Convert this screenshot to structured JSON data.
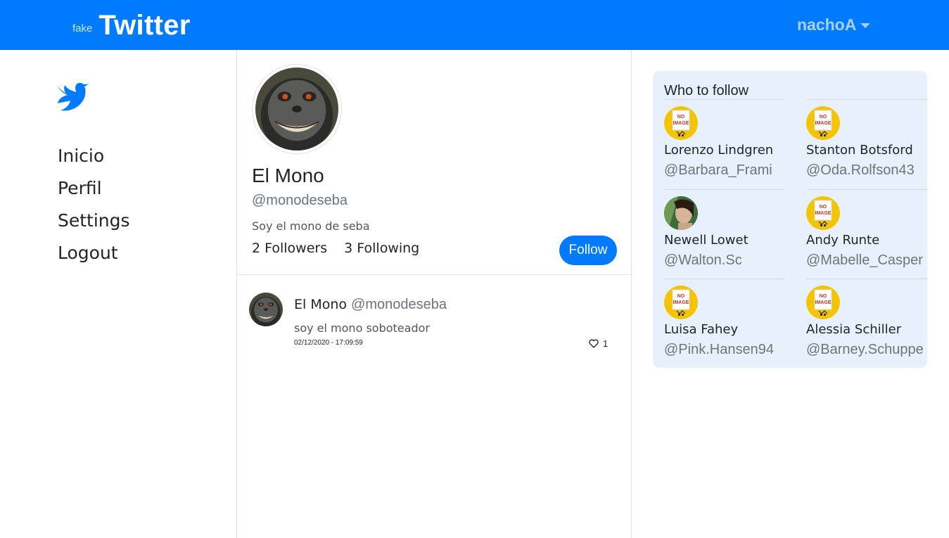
{
  "navbar": {
    "brand_small": "fake",
    "brand_big": "Twitter",
    "user": "nachoA",
    "colors": {
      "primary": "#007bff"
    }
  },
  "sidebar": {
    "logo_icon": "bird-icon",
    "items": [
      {
        "label": "Inicio"
      },
      {
        "label": "Perfil"
      },
      {
        "label": "Settings"
      },
      {
        "label": "Logout"
      }
    ]
  },
  "profile": {
    "name": "El Mono",
    "handle": "@monodeseba",
    "bio": "Soy el mono de seba",
    "followers": "2 Followers",
    "following": "3 Following",
    "follow_label": "Follow"
  },
  "tweets": [
    {
      "author": "El Mono",
      "handle": "@monodeseba",
      "text": "soy el mono soboteador",
      "date": "02/12/2020 - 17:09:59",
      "likes": "1"
    }
  ],
  "who_to_follow": {
    "title": "Who to follow",
    "users": [
      {
        "name": "Lorenzo Lindgren",
        "handle": "@Barbara_Frami",
        "avatar": "no-image"
      },
      {
        "name": "Stanton Botsford",
        "handle": "@Oda.Rolfson43",
        "avatar": "no-image"
      },
      {
        "name": "Newell Lowet",
        "handle": "@Walton.Sc",
        "avatar": "photo"
      },
      {
        "name": "Andy Runte",
        "handle": "@Mabelle_Casper",
        "avatar": "no-image"
      },
      {
        "name": "Luisa Fahey",
        "handle": "@Pink.Hansen94",
        "avatar": "no-image"
      },
      {
        "name": "Alessia Schiller",
        "handle": "@Barney.Schuppe",
        "avatar": "no-image"
      }
    ]
  }
}
